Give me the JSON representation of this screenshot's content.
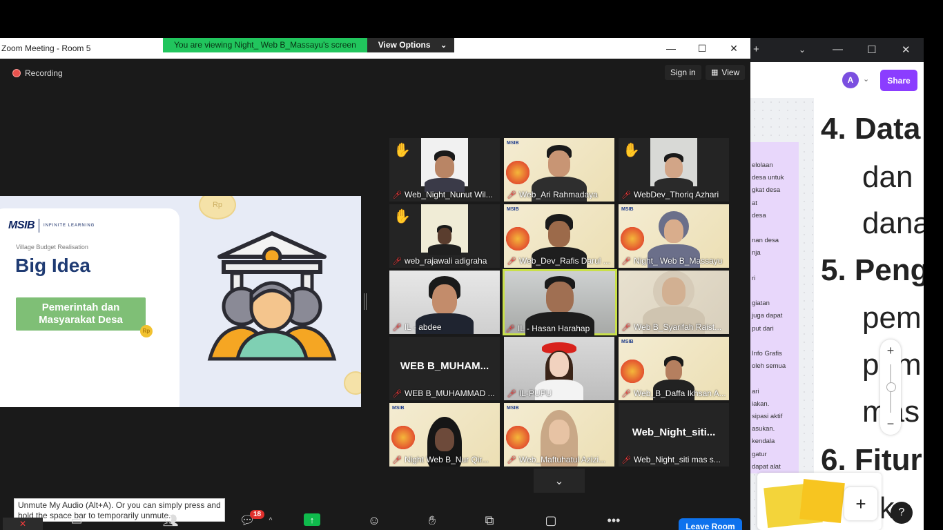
{
  "zoom": {
    "window_title": "Zoom Meeting - Room 5",
    "viewing_banner": "You are viewing Night_ Web B_Massayu's screen",
    "view_options_label": "View Options",
    "recording_label": "Recording",
    "sign_in_label": "Sign in",
    "view_label": "View",
    "slide": {
      "brand": "MSIB",
      "brand_sub": "INFINITE LEARNING",
      "subtitle": "Village Budget Realisation",
      "title": "Big Idea",
      "button_text": "Pemerintah dan Masyarakat Desa",
      "coin_text": "Rp"
    },
    "participants": [
      {
        "name": "Web_Night_Nunut Wil...",
        "hand": true
      },
      {
        "name": "Web_Ari Rahmadaya",
        "hand": false
      },
      {
        "name": "WebDev_Thoriq Azhari",
        "hand": true
      },
      {
        "name": "web_rajawali adigraha",
        "hand": true
      },
      {
        "name": "Web_Dev_Rafis Darul ...",
        "hand": false
      },
      {
        "name": "Night_ Web B_Massayu",
        "hand": false
      },
      {
        "name": "IL - abdee",
        "hand": false
      },
      {
        "name": "IL - Hasan Harahap",
        "hand": false
      },
      {
        "name": "Web B_Syarifah Raist...",
        "hand": false
      },
      {
        "name": "WEB B_MUHAMMAD ...",
        "big_name": "WEB B_MUHAM...",
        "hand": false
      },
      {
        "name": "IL-PUPU",
        "hand": false
      },
      {
        "name": "Web_B_Daffa Ikhsan A...",
        "hand": false
      },
      {
        "name": "Night Web B_Nur Qir...",
        "hand": false
      },
      {
        "name": "Web_Maftuhatul Azizi...",
        "hand": false
      },
      {
        "name": "Web_Night_siti mas s...",
        "big_name": "Web_Night_siti...",
        "hand": false
      }
    ],
    "tooltip": "Unmute My Audio (Alt+A). Or you can simply press and hold the space bar to temporarily unmute.",
    "chat_badge": "18",
    "leave_label": "Leave Room"
  },
  "browser": {
    "share_label": "Share",
    "avatar_letter": "A",
    "sticky_lines": [
      "elolaan",
      "desa untuk",
      "gkat desa",
      "at",
      "desa",
      "",
      "nan desa",
      "nja",
      "",
      "ri",
      "",
      "giatan",
      "juga dapat",
      "put dari",
      "",
      "Info Grafis",
      "oleh semua",
      "",
      "ari",
      "iakan.",
      "sipasi aktif",
      "asukan.",
      "kendala",
      "gatur",
      "dapat alat"
    ],
    "doc_lines": [
      {
        "text": "4. Data",
        "bold": true
      },
      {
        "text": "dan",
        "bold": false
      },
      {
        "text": "dana",
        "bold": false
      },
      {
        "text": "5. Peng",
        "bold": true
      },
      {
        "text": "pem",
        "bold": false
      },
      {
        "text": "pem",
        "bold": false
      },
      {
        "text": "mas",
        "bold": false
      },
      {
        "text": "6. Fitur",
        "bold": true
      },
      {
        "text": "eks",
        "bold": false
      }
    ],
    "help_label": "?"
  }
}
